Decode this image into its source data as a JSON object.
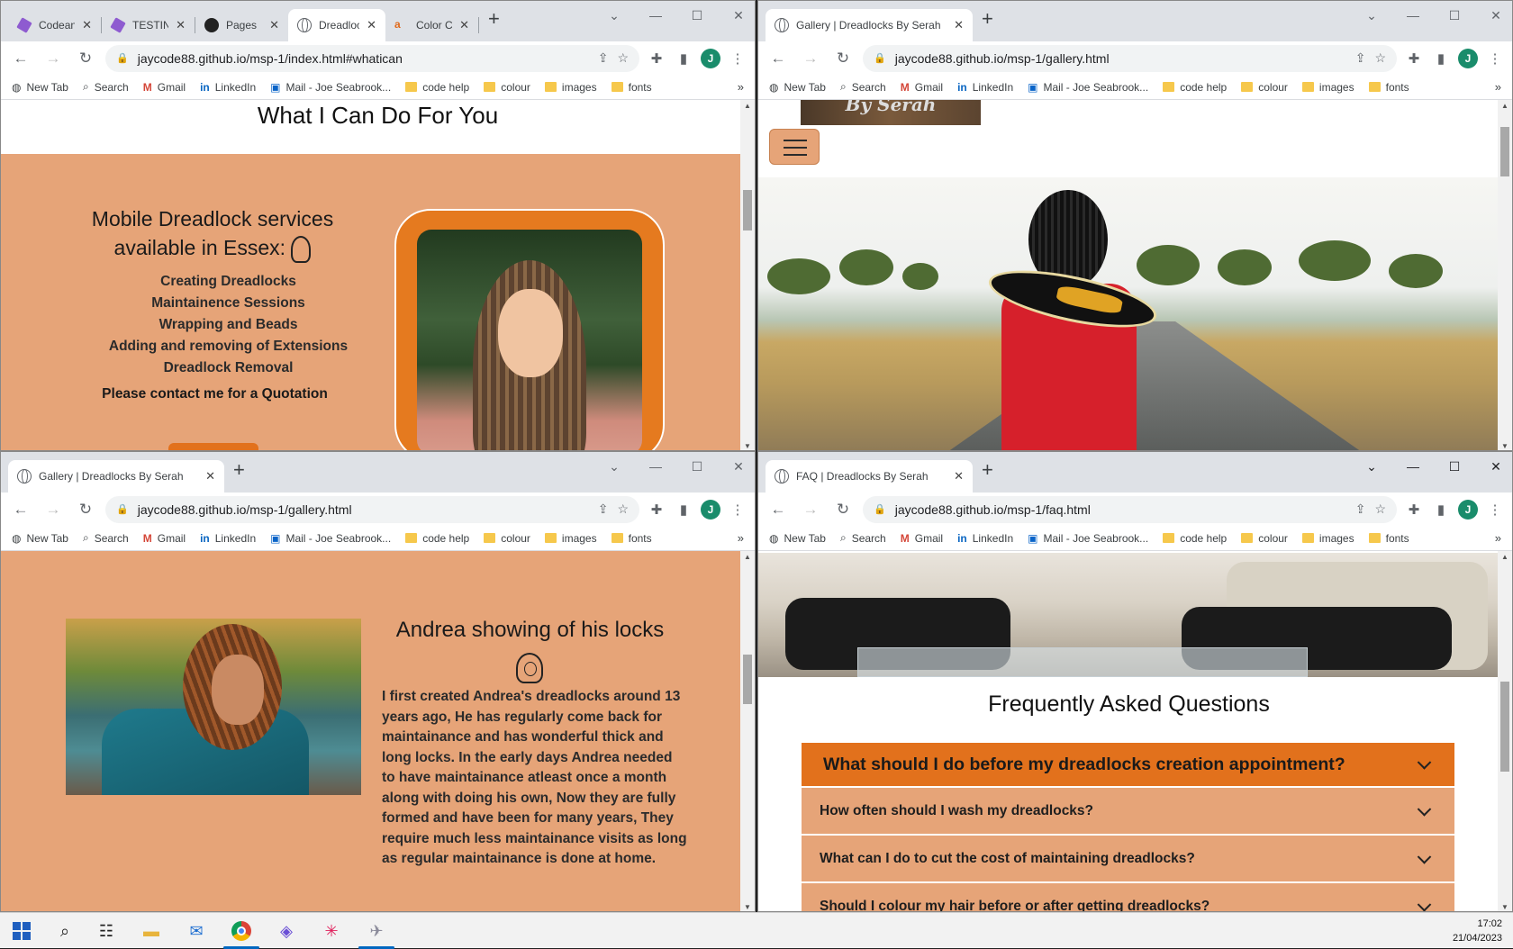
{
  "windows": {
    "w1": {
      "tabs": [
        {
          "title": "Codeany",
          "icon": "codeanywhere-icon"
        },
        {
          "title": "TESTING",
          "icon": "codeanywhere-icon"
        },
        {
          "title": "Pages",
          "icon": "github-icon"
        },
        {
          "title": "Dreadloc",
          "icon": "globe-icon"
        },
        {
          "title": "Color Co",
          "icon": "a11y-icon"
        }
      ],
      "url": "jaycode88.github.io/msp-1/index.html#whatican",
      "page": {
        "heading": "What I Can Do For You",
        "services_title": "Mobile Dreadlock services available in Essex:",
        "services": [
          "Creating Dreadlocks",
          "Maintainence Sessions",
          "Wrapping and Beads",
          "Adding and removing of Extensions",
          "Dreadlock Removal"
        ],
        "cta": "Please contact me for a Quotation"
      }
    },
    "w2": {
      "tabs": [
        {
          "title": "Gallery | Dreadlocks By Serah"
        }
      ],
      "url": "jaycode88.github.io/msp-1/gallery.html",
      "page": {
        "logo_text": "By Serah"
      }
    },
    "w3": {
      "tabs": [
        {
          "title": "Gallery | Dreadlocks By Serah"
        }
      ],
      "url": "jaycode88.github.io/msp-1/gallery.html",
      "page": {
        "title": "Andrea showing of his locks",
        "text": "I first created Andrea's dreadlocks around 13 years ago, He has regularly come back for maintainance and has wonderful thick and long locks. In the early days Andrea needed to have maintainance atleast once a month along with doing his own, Now they are fully formed and have been for many years, They require much less maintainance visits as long as regular maintainance is done at home."
      }
    },
    "w4": {
      "tabs": [
        {
          "title": "FAQ | Dreadlocks By Serah"
        }
      ],
      "url": "jaycode88.github.io/msp-1/faq.html",
      "page": {
        "title": "Frequently Asked Questions",
        "questions": [
          "What should I do before my dreadlocks creation appointment?",
          "How often should I wash my dreadlocks?",
          "What can I do to cut the cost of maintaining dreadlocks?",
          "Should I colour my hair before or after getting dreadlocks?"
        ]
      }
    }
  },
  "bookmarks": [
    "New Tab",
    "Search",
    "Gmail",
    "LinkedIn",
    "Mail - Joe Seabrook...",
    "code help",
    "colour",
    "images",
    "fonts"
  ],
  "profile_initial": "J",
  "taskbar": {
    "time": "17:02",
    "date": "21/04/2023"
  },
  "colors": {
    "peach": "#e6a478",
    "orange": "#e2711c",
    "chrome_tab_bg": "#dee1e6"
  }
}
